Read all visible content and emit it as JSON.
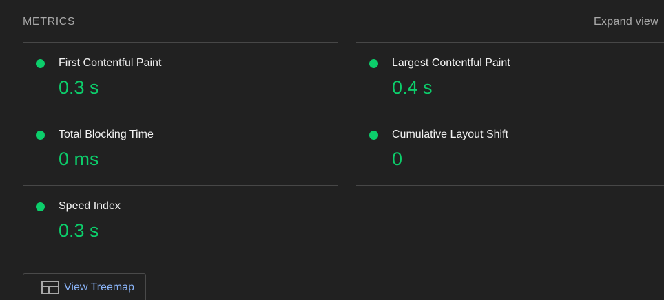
{
  "header": {
    "title": "METRICS",
    "expand_label": "Expand view"
  },
  "colors": {
    "pass": "#0cce6b",
    "link": "#8ab4f8"
  },
  "metrics_left": [
    {
      "title": "First Contentful Paint",
      "value": "0.3 s",
      "status": "pass"
    },
    {
      "title": "Total Blocking Time",
      "value": "0 ms",
      "status": "pass"
    },
    {
      "title": "Speed Index",
      "value": "0.3 s",
      "status": "pass"
    }
  ],
  "metrics_right": [
    {
      "title": "Largest Contentful Paint",
      "value": "0.4 s",
      "status": "pass"
    },
    {
      "title": "Cumulative Layout Shift",
      "value": "0",
      "status": "pass"
    }
  ],
  "treemap": {
    "label": "View Treemap",
    "icon": "treemap-icon"
  }
}
